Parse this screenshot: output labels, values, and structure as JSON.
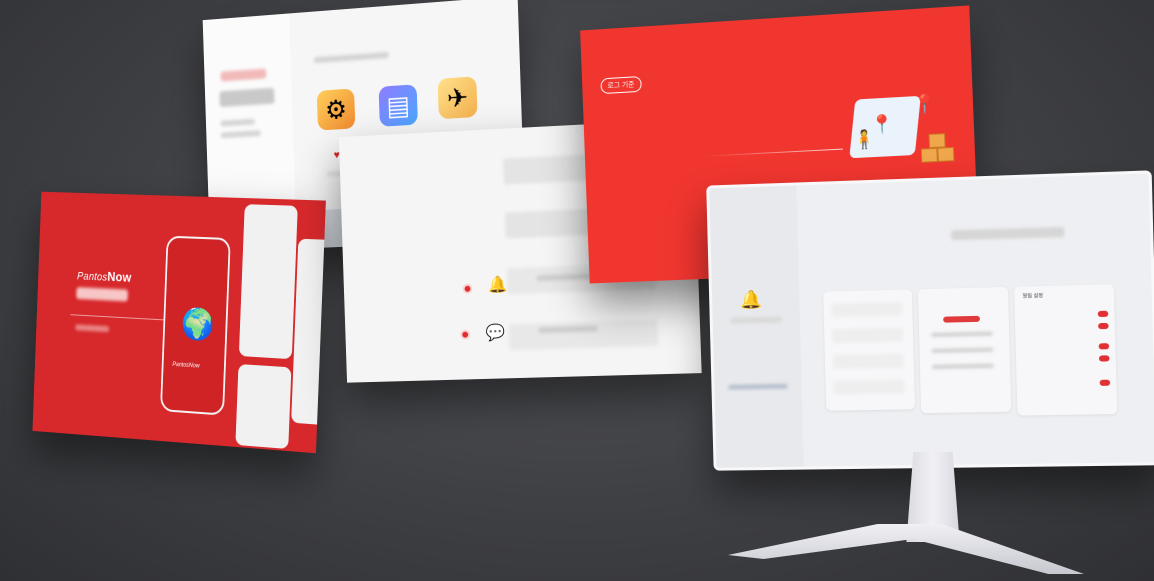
{
  "panel_b": {
    "brand_prefix": "Pantos",
    "brand_suffix": "Now",
    "phone_brand": "PantosNow"
  },
  "panel_d": {
    "badge": "로그 기준"
  },
  "monitor": {
    "settings_title": "알림 설정"
  },
  "icons": {
    "gear": "gear-icon",
    "doc": "document-icon",
    "plane": "airplane-icon",
    "globe": "globe-icon",
    "bell": "bell-icon",
    "pin": "location-pin-icon"
  },
  "colors": {
    "brand_red": "#d7282b",
    "accent_red": "#f1352f",
    "background": "#3f4044"
  }
}
